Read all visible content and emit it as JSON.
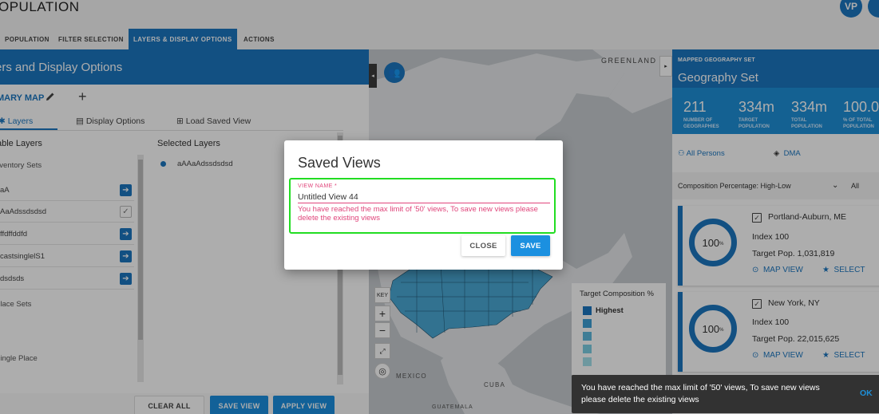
{
  "app_title": "OPULATION",
  "user_initials": "VP",
  "tabs": [
    {
      "label": "POPULATION"
    },
    {
      "label": "FILTER SELECTION"
    },
    {
      "label": "LAYERS & DISPLAY OPTIONS"
    },
    {
      "label": "ACTIONS"
    }
  ],
  "left_panel": {
    "title": "ers and Display Options",
    "map_name": "MARY MAP",
    "subtabs": [
      "Layers",
      "Display Options",
      "Load Saved View"
    ],
    "available_title": "able Layers",
    "selected_title": "Selected Layers",
    "sections": [
      "nventory Sets",
      "Place Sets",
      "Single Place"
    ],
    "inventory_items": [
      "aA",
      "AaAdssdsdsd",
      "ffdffddfd",
      "castsinglelS1",
      "dsdsds"
    ],
    "selected_items": [
      "aAAaAdssdsdsd"
    ],
    "buttons": {
      "clear_all": "CLEAR ALL",
      "save_view": "SAVE VIEW",
      "apply_view": "APPLY VIEW"
    }
  },
  "map": {
    "labels": {
      "greenland": "GREENLAND",
      "mexico": "MEXICO",
      "cuba": "CUBA",
      "guatemala": "GUATEMALA"
    },
    "key_label": "KEY",
    "legend": {
      "title": "Target Composition %",
      "highest": "Highest"
    }
  },
  "dialog": {
    "title": "Saved Views",
    "field_label": "VIEW NAME *",
    "field_value": "Untitled View 44",
    "error": "You have reached the max limit of '50' views, To save new views please delete the existing views",
    "close_label": "CLOSE",
    "save_label": "SAVE"
  },
  "right_panel": {
    "label": "MAPPED GEOGRAPHY SET",
    "title": "Geography Set",
    "stats": [
      {
        "value": "211",
        "label1": "NUMBER OF",
        "label2": "GEOGRAPHIES"
      },
      {
        "value": "334m",
        "label1": "TARGET",
        "label2": "POPULATION"
      },
      {
        "value": "334m",
        "label1": "TOTAL",
        "label2": "POPULATION"
      },
      {
        "value": "100.0",
        "label1": "% OF TOTAL",
        "label2": "POPULATION"
      }
    ],
    "audience": "All Persons",
    "geo_type": "DMA",
    "sort_label": "Composition Percentage: High-Low",
    "filter_label": "All",
    "cards": [
      {
        "pct": "100",
        "name": "Portland-Auburn, ME",
        "index": "Index 100",
        "target": "Target Pop. 1,031,819",
        "map_view": "MAP VIEW",
        "select": "SELECT"
      },
      {
        "pct": "100",
        "name": "New York, NY",
        "index": "Index 100",
        "target": "Target Pop. 22,015,625",
        "map_view": "MAP VIEW",
        "select": "SELECT"
      }
    ]
  },
  "snackbar": {
    "message": "You have reached the max limit of '50' views, To save new views please delete the existing views",
    "action": "OK"
  },
  "colors": {
    "primary": "#1b76c0",
    "accent": "#1e8fd8",
    "error": "#e0457b",
    "highlight": "#22dd22"
  }
}
